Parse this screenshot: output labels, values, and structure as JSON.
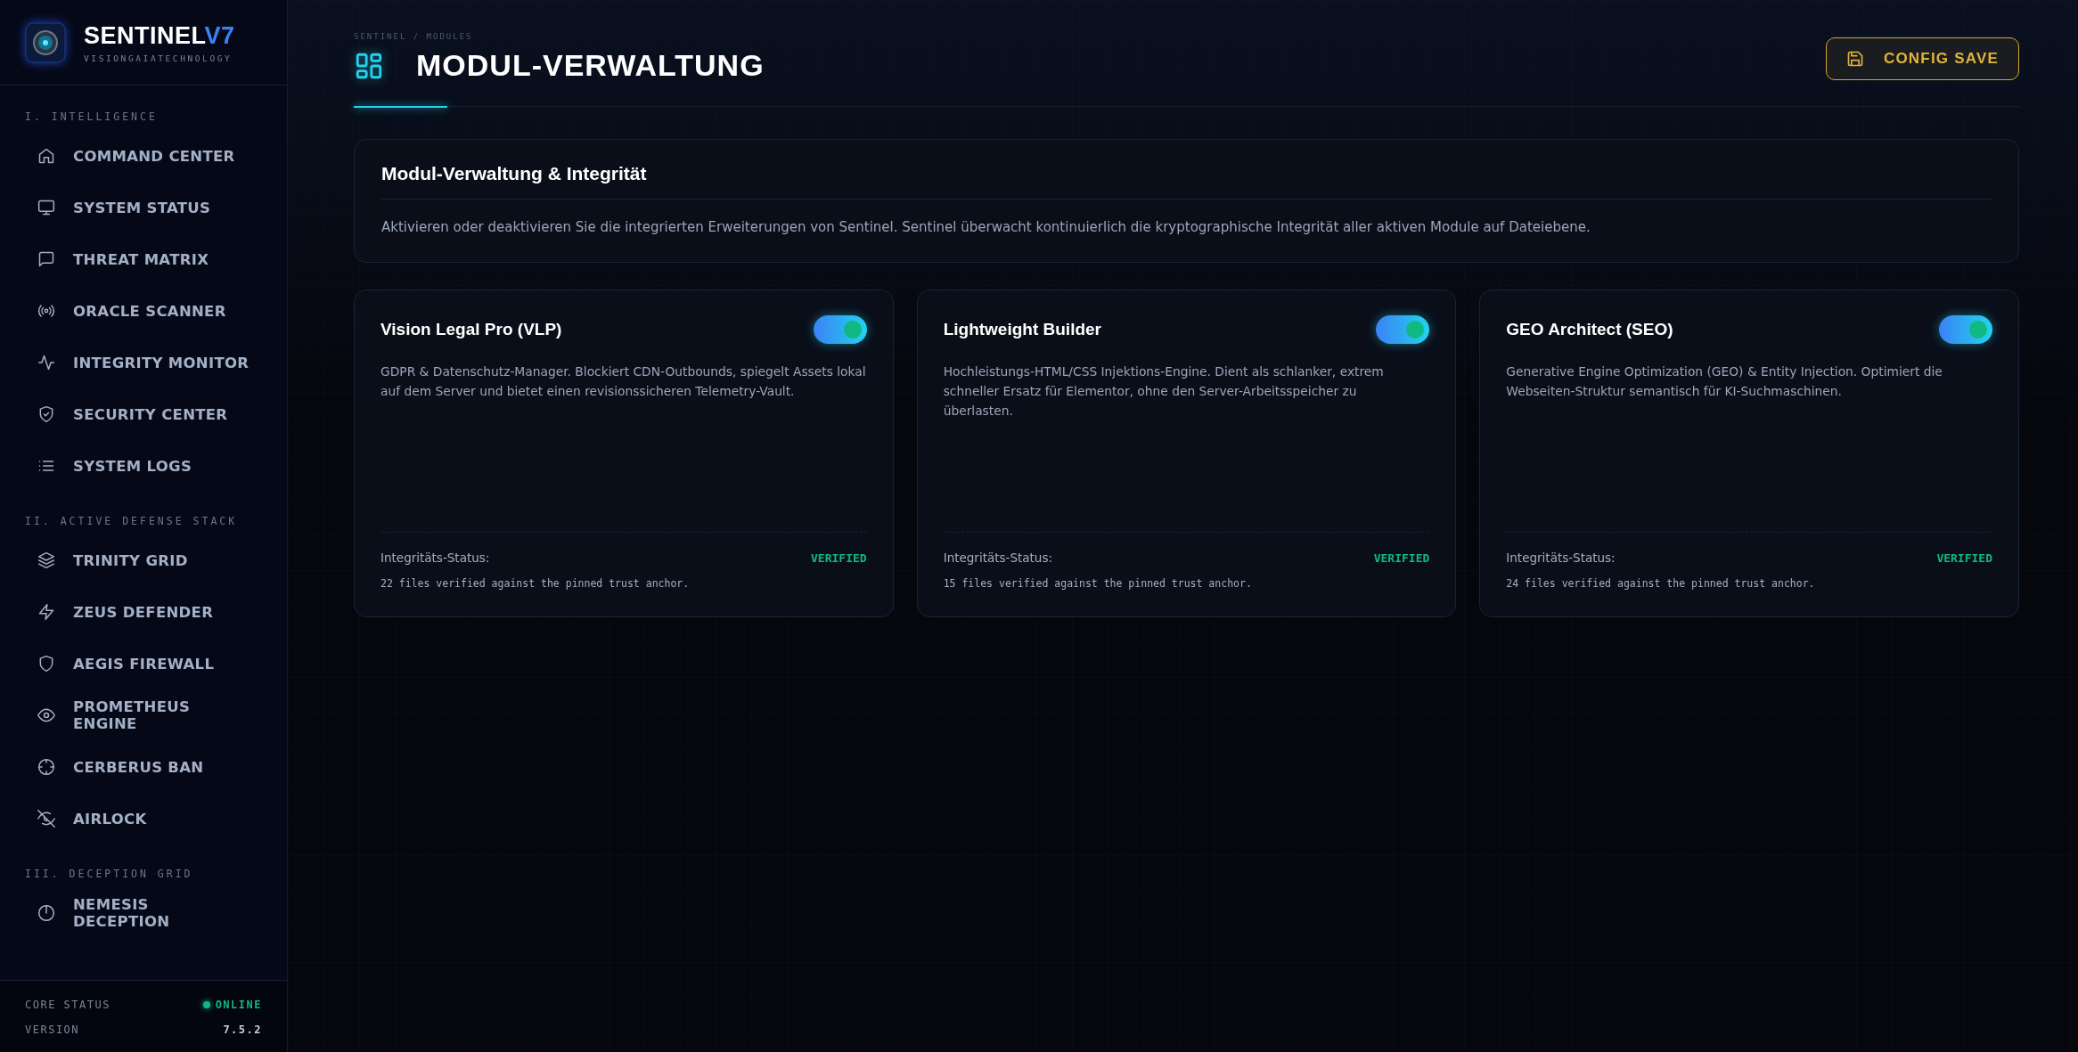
{
  "sidebar": {
    "brand": {
      "name": "SENTINEL",
      "version": "V7",
      "subtitle": "VISIONGAIATECHNOLOGY"
    },
    "sections": [
      {
        "label": "I. INTELLIGENCE",
        "items": [
          {
            "label": "COMMAND CENTER"
          },
          {
            "label": "SYSTEM STATUS"
          },
          {
            "label": "THREAT MATRIX"
          },
          {
            "label": "ORACLE SCANNER"
          },
          {
            "label": "INTEGRITY MONITOR"
          },
          {
            "label": "SECURITY CENTER"
          },
          {
            "label": "SYSTEM LOGS"
          }
        ]
      },
      {
        "label": "II. ACTIVE DEFENSE STACK",
        "items": [
          {
            "label": "TRINITY GRID"
          },
          {
            "label": "ZEUS DEFENDER"
          },
          {
            "label": "AEGIS FIREWALL"
          },
          {
            "label": "PROMETHEUS ENGINE"
          },
          {
            "label": "CERBERUS BAN"
          },
          {
            "label": "AIRLOCK"
          }
        ]
      },
      {
        "label": "III. DECEPTION GRID",
        "items": [
          {
            "label": "NEMESIS DECEPTION"
          }
        ]
      }
    ],
    "footer": {
      "status_label": "CORE STATUS",
      "status": "ONLINE",
      "online": true,
      "version_label": "VERSION",
      "version": "7.5.2"
    }
  },
  "header": {
    "breadcrumb": "SENTINEL / MODULES",
    "title": "MODUL-VERWALTUNG",
    "save_button": "CONFIG SAVE"
  },
  "intro": {
    "title": "Modul-Verwaltung & Integrität",
    "text": "Aktivieren oder deaktivieren Sie die integrierten Erweiterungen von Sentinel. Sentinel überwacht kontinuierlich die kryptographische Integrität aller aktiven Module auf Dateiebene."
  },
  "modules": [
    {
      "name": "Vision Legal Pro (VLP)",
      "enabled": true,
      "description": "GDPR & Datenschutz-Manager. Blockiert CDN-Outbounds, spiegelt Assets lokal auf dem Server und bietet einen revisionssicheren Telemetry-Vault.",
      "status_label": "Integritäts-Status:",
      "status": "VERIFIED",
      "verified": true,
      "detail": "22 files verified against the pinned trust anchor."
    },
    {
      "name": "Lightweight Builder",
      "enabled": true,
      "description": "Hochleistungs-HTML/CSS Injektions-Engine. Dient als schlanker, extrem schneller Ersatz für Elementor, ohne den Server-Arbeitsspeicher zu überlasten.",
      "status_label": "Integritäts-Status:",
      "status": "VERIFIED",
      "verified": true,
      "detail": "15 files verified against the pinned trust anchor."
    },
    {
      "name": "GEO Architect (SEO)",
      "enabled": true,
      "description": "Generative Engine Optimization (GEO) & Entity Injection. Optimiert die Webseiten-Struktur semantisch für KI-Suchmaschinen.",
      "status_label": "Integritäts-Status:",
      "status": "VERIFIED",
      "verified": true,
      "detail": "24 files verified against the pinned trust anchor."
    }
  ]
}
